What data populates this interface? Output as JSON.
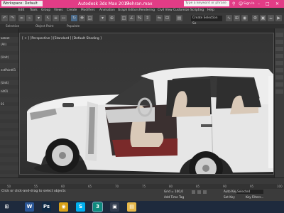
{
  "titlebar": {
    "workspace": "Workspace: Default",
    "app_title": "Autodesk 3ds Max 2017",
    "file_name": "Mehran.max",
    "search_placeholder": "Type a keyword or phrase",
    "sign_in": "Sign In"
  },
  "menu": [
    "Edit",
    "Tools",
    "Group",
    "Views",
    "Create",
    "Modifiers",
    "Animation",
    "Graph Editors",
    "Rendering",
    "Civil View",
    "Customize",
    "Scripting",
    "Help"
  ],
  "toolbar": {
    "selection_set_placeholder": "Create Selection Se"
  },
  "ribbon_tabs": [
    "Selection",
    "Object Paint",
    "Populate"
  ],
  "explorer": {
    "header": "Select",
    "rows": [
      "",
      "(All)",
      "",
      "",
      "(Unit)",
      "",
      "",
      "ectPoint01",
      "",
      "",
      "(Unit)",
      "",
      "nit01",
      "",
      "",
      "01",
      "",
      "",
      "",
      "",
      "",
      "",
      "",
      "",
      "",
      "",
      "",
      "",
      "",
      "",
      "",
      ""
    ]
  },
  "viewport": {
    "label": "[ + ] [Perspective ] [Standard ] [Default Shading ]"
  },
  "command_panel": {
    "rows": [
      "",
      "",
      "",
      "",
      "",
      "",
      "",
      "",
      ""
    ]
  },
  "timeline": {
    "ticks": [
      "50",
      "55",
      "60",
      "65",
      "70",
      "75",
      "80",
      "85",
      "90",
      "95",
      "100"
    ]
  },
  "status": {
    "prompt": "Click or click-and-drag to select objects",
    "grid": "Grid = 100,0",
    "add_time_tag": "Add Time Tag",
    "auto_key": "Auto Key",
    "set_key": "Set Key",
    "selected": "Selected",
    "key_filters": "Key Filters..."
  },
  "taskbar": {
    "apps": [
      {
        "name": "word",
        "label": "W",
        "color": "#2b5797"
      },
      {
        "name": "photoshop",
        "label": "Ps",
        "color": "#0f2a44"
      },
      {
        "name": "chrome",
        "label": "◉",
        "color": "#d8a118"
      },
      {
        "name": "skype",
        "label": "S",
        "color": "#00aff0"
      },
      {
        "name": "3dsmax",
        "label": "3",
        "color": "#0e8a7e"
      },
      {
        "name": "media",
        "label": "▣",
        "color": "#333d4f"
      },
      {
        "name": "explorer",
        "label": "▤",
        "color": "#e6b84a"
      }
    ]
  },
  "colors": {
    "titlebar": "#e23c86",
    "viewport": "#363636",
    "car_body": "#e8e8e8"
  }
}
